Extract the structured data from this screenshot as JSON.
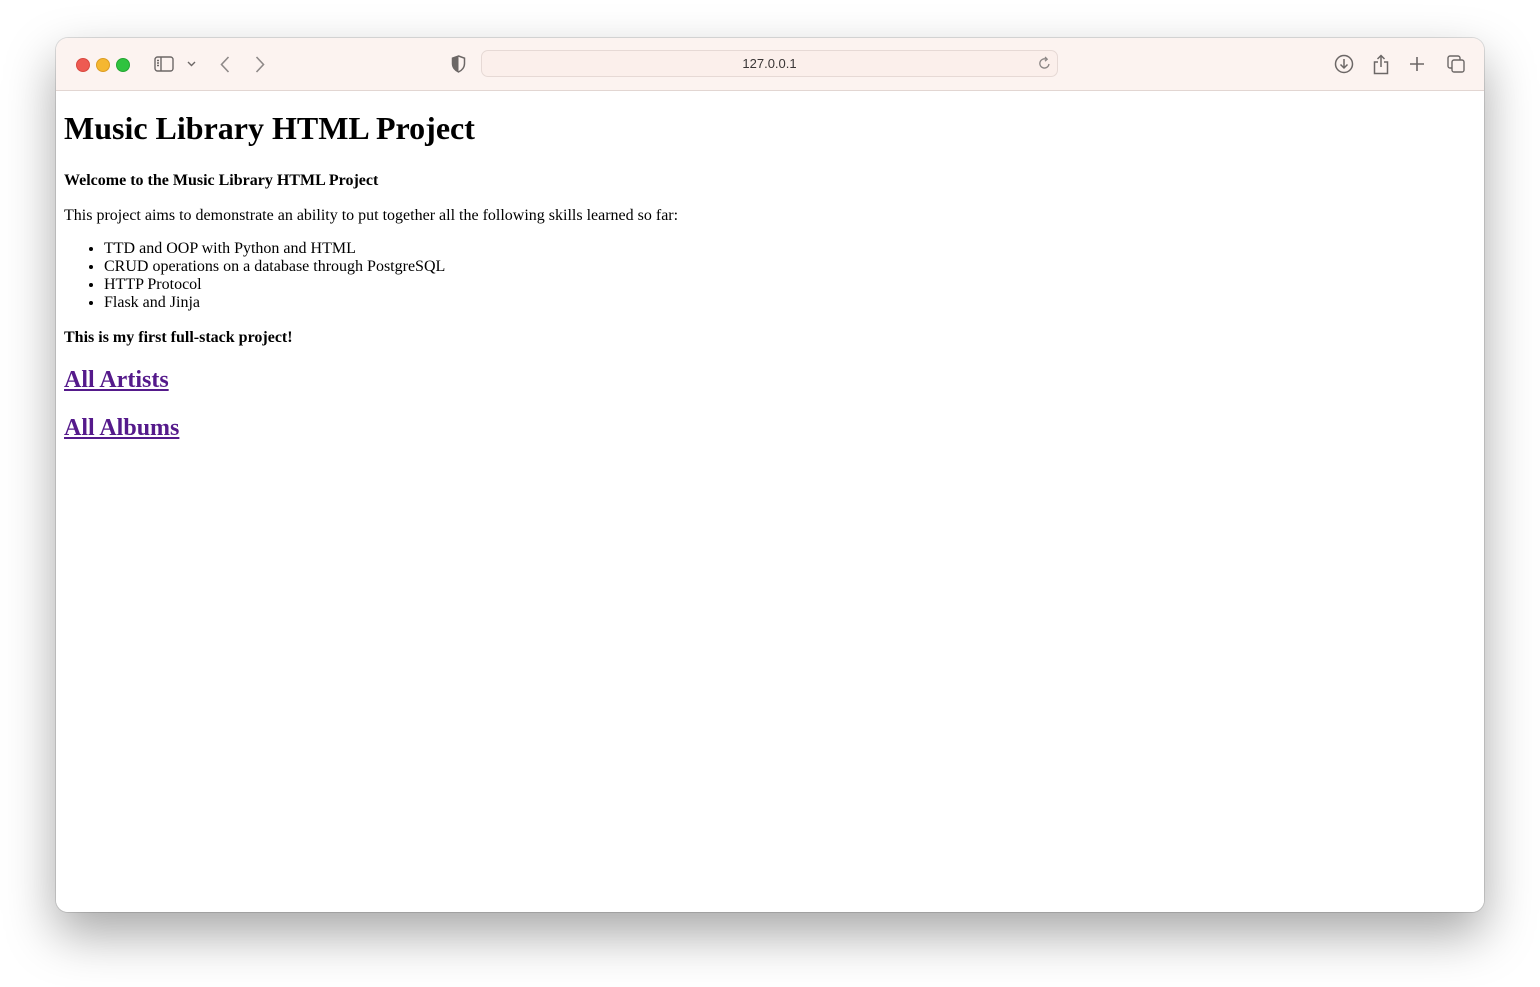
{
  "browser": {
    "url": "127.0.0.1",
    "icons": {
      "sidebar": "sidebar-icon",
      "sidebar_menu": "chevron-down-icon",
      "back": "chevron-left-icon",
      "forward": "chevron-right-icon",
      "privacy": "shield-icon",
      "reload": "reload-icon",
      "downloads": "download-icon",
      "share": "share-icon",
      "new_tab": "plus-icon",
      "tabs": "tab-overview-icon"
    }
  },
  "page": {
    "title": "Music Library HTML Project",
    "welcome": "Welcome to the Music Library HTML Project",
    "intro": "This project aims to demonstrate an ability to put together all the following skills learned so far:",
    "skills": [
      "TTD and OOP with Python and HTML",
      "CRUD operations on a database through PostgreSQL",
      "HTTP Protocol",
      "Flask and Jinja"
    ],
    "closing": "This is my first full-stack project!",
    "links": [
      {
        "label": "All Artists"
      },
      {
        "label": "All Albums"
      }
    ],
    "link_color": "#551a8b"
  }
}
